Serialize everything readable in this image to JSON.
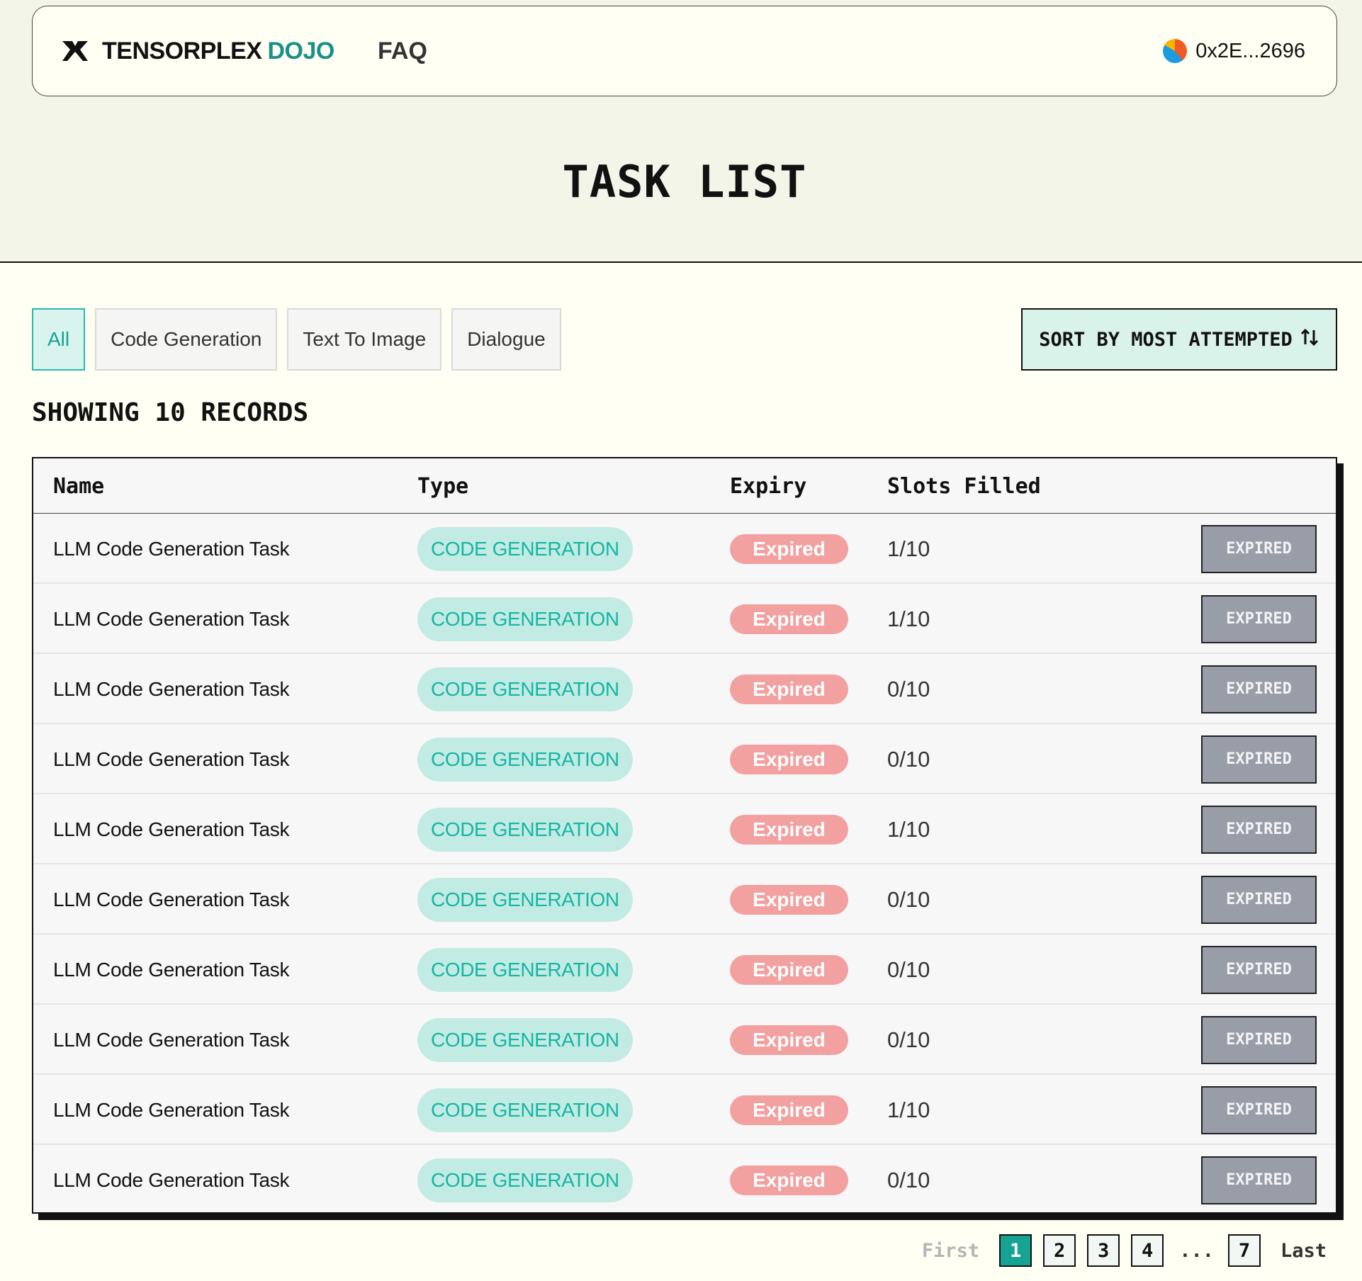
{
  "nav": {
    "brand": "TENSORPLEX",
    "brand_accent": "DOJO",
    "faq": "FAQ",
    "wallet_address": "0x2E...2696"
  },
  "page": {
    "title": "TASK LIST"
  },
  "filters": [
    "All",
    "Code Generation",
    "Text To Image",
    "Dialogue"
  ],
  "active_filter": "All",
  "sort": {
    "label": "SORT BY MOST ATTEMPTED",
    "icon": "sort-arrows-icon"
  },
  "records_label": "SHOWING 10 RECORDS",
  "table": {
    "headers": {
      "name": "Name",
      "type": "Type",
      "expiry": "Expiry",
      "slots": "Slots Filled"
    },
    "rows": [
      {
        "name": "LLM Code Generation Task",
        "type": "CODE GENERATION",
        "expiry": "Expired",
        "slots": "1/10",
        "action": "EXPIRED"
      },
      {
        "name": "LLM Code Generation Task",
        "type": "CODE GENERATION",
        "expiry": "Expired",
        "slots": "1/10",
        "action": "EXPIRED"
      },
      {
        "name": "LLM Code Generation Task",
        "type": "CODE GENERATION",
        "expiry": "Expired",
        "slots": "0/10",
        "action": "EXPIRED"
      },
      {
        "name": "LLM Code Generation Task",
        "type": "CODE GENERATION",
        "expiry": "Expired",
        "slots": "0/10",
        "action": "EXPIRED"
      },
      {
        "name": "LLM Code Generation Task",
        "type": "CODE GENERATION",
        "expiry": "Expired",
        "slots": "1/10",
        "action": "EXPIRED"
      },
      {
        "name": "LLM Code Generation Task",
        "type": "CODE GENERATION",
        "expiry": "Expired",
        "slots": "0/10",
        "action": "EXPIRED"
      },
      {
        "name": "LLM Code Generation Task",
        "type": "CODE GENERATION",
        "expiry": "Expired",
        "slots": "0/10",
        "action": "EXPIRED"
      },
      {
        "name": "LLM Code Generation Task",
        "type": "CODE GENERATION",
        "expiry": "Expired",
        "slots": "0/10",
        "action": "EXPIRED"
      },
      {
        "name": "LLM Code Generation Task",
        "type": "CODE GENERATION",
        "expiry": "Expired",
        "slots": "1/10",
        "action": "EXPIRED"
      },
      {
        "name": "LLM Code Generation Task",
        "type": "CODE GENERATION",
        "expiry": "Expired",
        "slots": "0/10",
        "action": "EXPIRED"
      }
    ]
  },
  "pagination": {
    "first": "First",
    "pages": [
      "1",
      "2",
      "3",
      "4"
    ],
    "ellipsis": "...",
    "last_page": "7",
    "last": "Last",
    "current": "1"
  },
  "colors": {
    "accent": "#16a394",
    "background": "#fffff4",
    "hero": "#f3f5e9",
    "expired_pill": "#f2a0a0",
    "type_pill": "#c2ebe3"
  }
}
